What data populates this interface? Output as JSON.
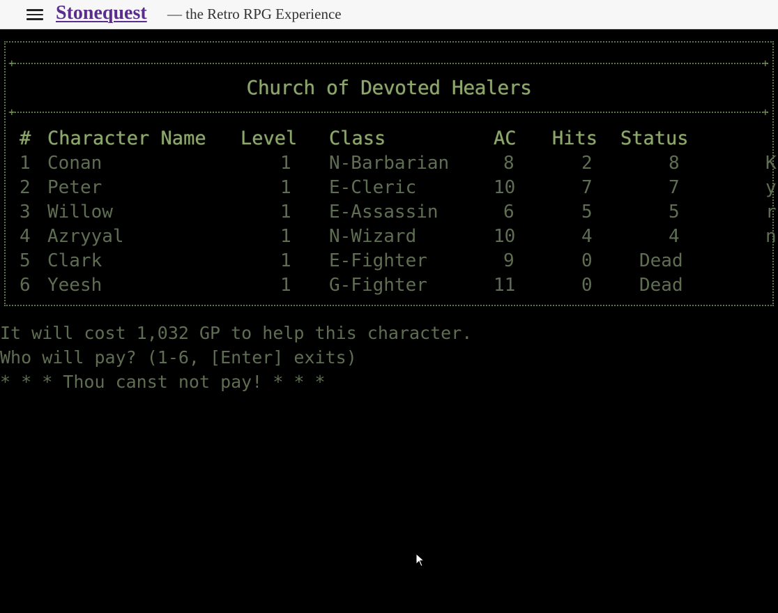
{
  "header": {
    "menu_icon": "hamburger-menu-icon",
    "site_title": "Stonequest",
    "tagline": "— the Retro RPG Experience",
    "title_color": "#5a2e8c"
  },
  "screen": {
    "heading": "Church of Devoted Healers",
    "text_color": "#5f6e52",
    "heading_color": "#8da66b",
    "columns": {
      "num": "#",
      "name": "Character Name",
      "level": "Level",
      "class": "Class",
      "ac": "AC",
      "hits": "Hits",
      "status": "Status"
    },
    "rows": [
      {
        "num": "1",
        "name": "Conan",
        "level": "1",
        "class": "N-Barbarian",
        "ac": "8",
        "hits": "2",
        "status": "8",
        "extra": "K"
      },
      {
        "num": "2",
        "name": "Peter",
        "level": "1",
        "class": "E-Cleric",
        "ac": "10",
        "hits": "7",
        "status": "7",
        "extra": "y"
      },
      {
        "num": "3",
        "name": "Willow",
        "level": "1",
        "class": "E-Assassin",
        "ac": "6",
        "hits": "5",
        "status": "5",
        "extra": "r"
      },
      {
        "num": "4",
        "name": "Azryyal",
        "level": "1",
        "class": "N-Wizard",
        "ac": "10",
        "hits": "4",
        "status": "4",
        "extra": "n"
      },
      {
        "num": "5",
        "name": "Clark",
        "level": "1",
        "class": "E-Fighter",
        "ac": "9",
        "hits": "0",
        "status": "Dead",
        "extra": ""
      },
      {
        "num": "6",
        "name": "Yeesh",
        "level": "1",
        "class": "G-Fighter",
        "ac": "11",
        "hits": "0",
        "status": "Dead",
        "extra": ""
      }
    ],
    "messages": {
      "cost": "It will cost 1,032 GP to help this character.",
      "prompt": "Who will pay? (1-6, [Enter] exits)",
      "error": "* * * Thou canst not pay! * * *"
    }
  }
}
